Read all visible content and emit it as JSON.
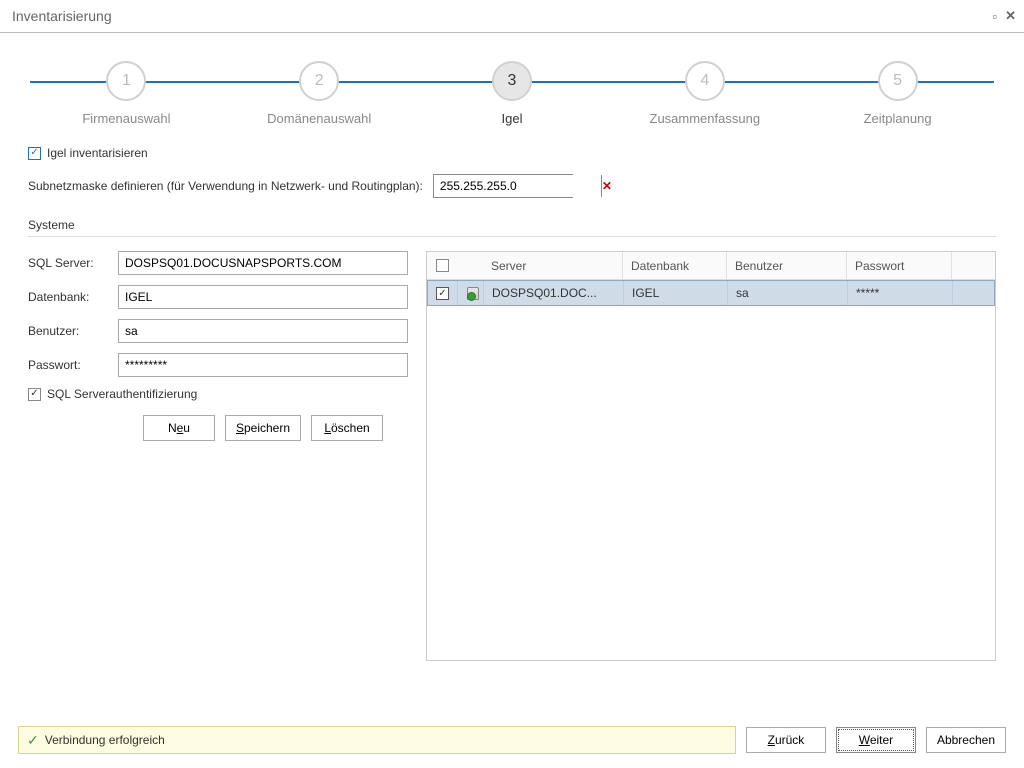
{
  "window": {
    "title": "Inventarisierung"
  },
  "steps": [
    {
      "num": "1",
      "label": "Firmenauswahl"
    },
    {
      "num": "2",
      "label": "Domänenauswahl"
    },
    {
      "num": "3",
      "label": "Igel"
    },
    {
      "num": "4",
      "label": "Zusammenfassung"
    },
    {
      "num": "5",
      "label": "Zeitplanung"
    }
  ],
  "igel_checkbox_label": "Igel inventarisieren",
  "subnet": {
    "label": "Subnetzmaske definieren (für Verwendung in Netzwerk- und Routingplan):",
    "value": "255.255.255.0"
  },
  "systems_label": "Systeme",
  "form": {
    "sql_server_label": "SQL Server:",
    "sql_server_value": "DOSPSQ01.DOCUSNAPSPORTS.COM",
    "db_label": "Datenbank:",
    "db_value": "IGEL",
    "user_label": "Benutzer:",
    "user_value": "sa",
    "pass_label": "Passwort:",
    "pass_value": "*********",
    "sql_auth_label": "SQL Serverauthentifizierung"
  },
  "buttons": {
    "neu_pre": "N",
    "neu_ul": "e",
    "neu_post": "u",
    "speichern_pre": "",
    "speichern_ul": "S",
    "speichern_post": "peichern",
    "loeschen_pre": "",
    "loeschen_ul": "L",
    "loeschen_post": "öschen"
  },
  "grid": {
    "headers": {
      "server": "Server",
      "db": "Datenbank",
      "user": "Benutzer",
      "pass": "Passwort"
    },
    "rows": [
      {
        "server": "DOSPSQ01.DOC...",
        "db": "IGEL",
        "user": "sa",
        "pass": "*****"
      }
    ]
  },
  "status_text": "Verbindung erfolgreich",
  "footer": {
    "back_pre": "",
    "back_ul": "Z",
    "back_post": "urück",
    "next_pre": "",
    "next_ul": "W",
    "next_post": "eiter",
    "cancel": "Abbrechen"
  }
}
